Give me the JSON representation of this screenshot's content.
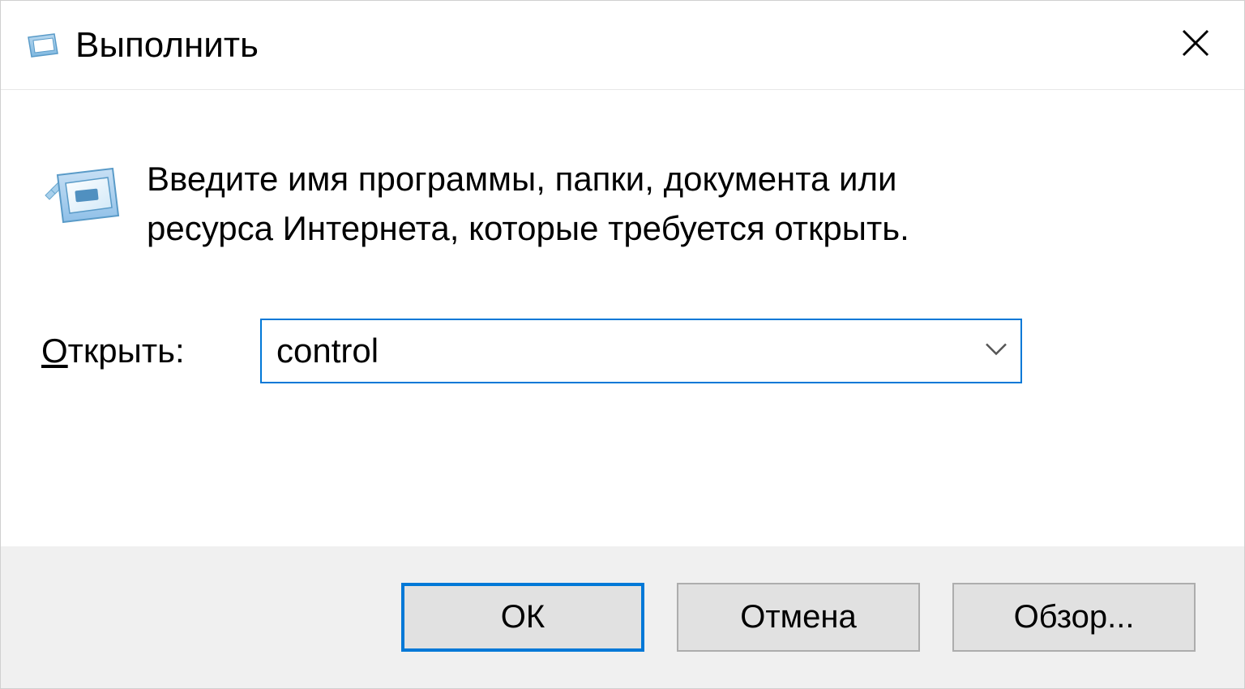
{
  "titlebar": {
    "title": "Выполнить"
  },
  "body": {
    "description": "Введите имя программы, папки, документа или ресурса Интернета, которые требуется открыть.",
    "open_label_prefix": "О",
    "open_label_rest": "ткрыть:",
    "input_value": "control"
  },
  "footer": {
    "ok_label": "ОК",
    "cancel_label": "Отмена",
    "browse_label": "Обзор..."
  }
}
